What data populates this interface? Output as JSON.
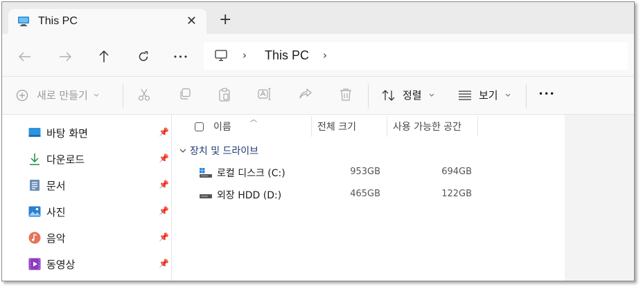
{
  "tab": {
    "title": "This PC",
    "close": "✕",
    "new_tab": "+"
  },
  "nav": {
    "back": "←",
    "forward": "→",
    "up": "↑",
    "refresh": "↻",
    "more": "•••"
  },
  "address": {
    "sep": "›",
    "location": "This PC"
  },
  "toolbar": {
    "new_label": "새로 만들기",
    "sort_label": "정렬",
    "view_label": "보기",
    "more": "•••"
  },
  "sidebar": {
    "items": [
      {
        "label": "바탕 화면",
        "icon": "desktop-icon"
      },
      {
        "label": "다운로드",
        "icon": "download-icon"
      },
      {
        "label": "문서",
        "icon": "document-icon"
      },
      {
        "label": "사진",
        "icon": "pictures-icon"
      },
      {
        "label": "음악",
        "icon": "music-icon"
      },
      {
        "label": "동영상",
        "icon": "video-icon"
      }
    ]
  },
  "columns": {
    "name": "이름",
    "total": "전체 크기",
    "free": "사용 가능한 공간"
  },
  "group": {
    "label": "장치 및 드라이브"
  },
  "drives": [
    {
      "name": "로컬 디스크 (C:)",
      "total": "953GB",
      "free": "694GB"
    },
    {
      "name": "외장 HDD (D:)",
      "total": "465GB",
      "free": "122GB"
    }
  ],
  "colors": {
    "accent": "#0078d4",
    "tabbar": "#ebebeb",
    "chrome": "#f9f9f9"
  }
}
